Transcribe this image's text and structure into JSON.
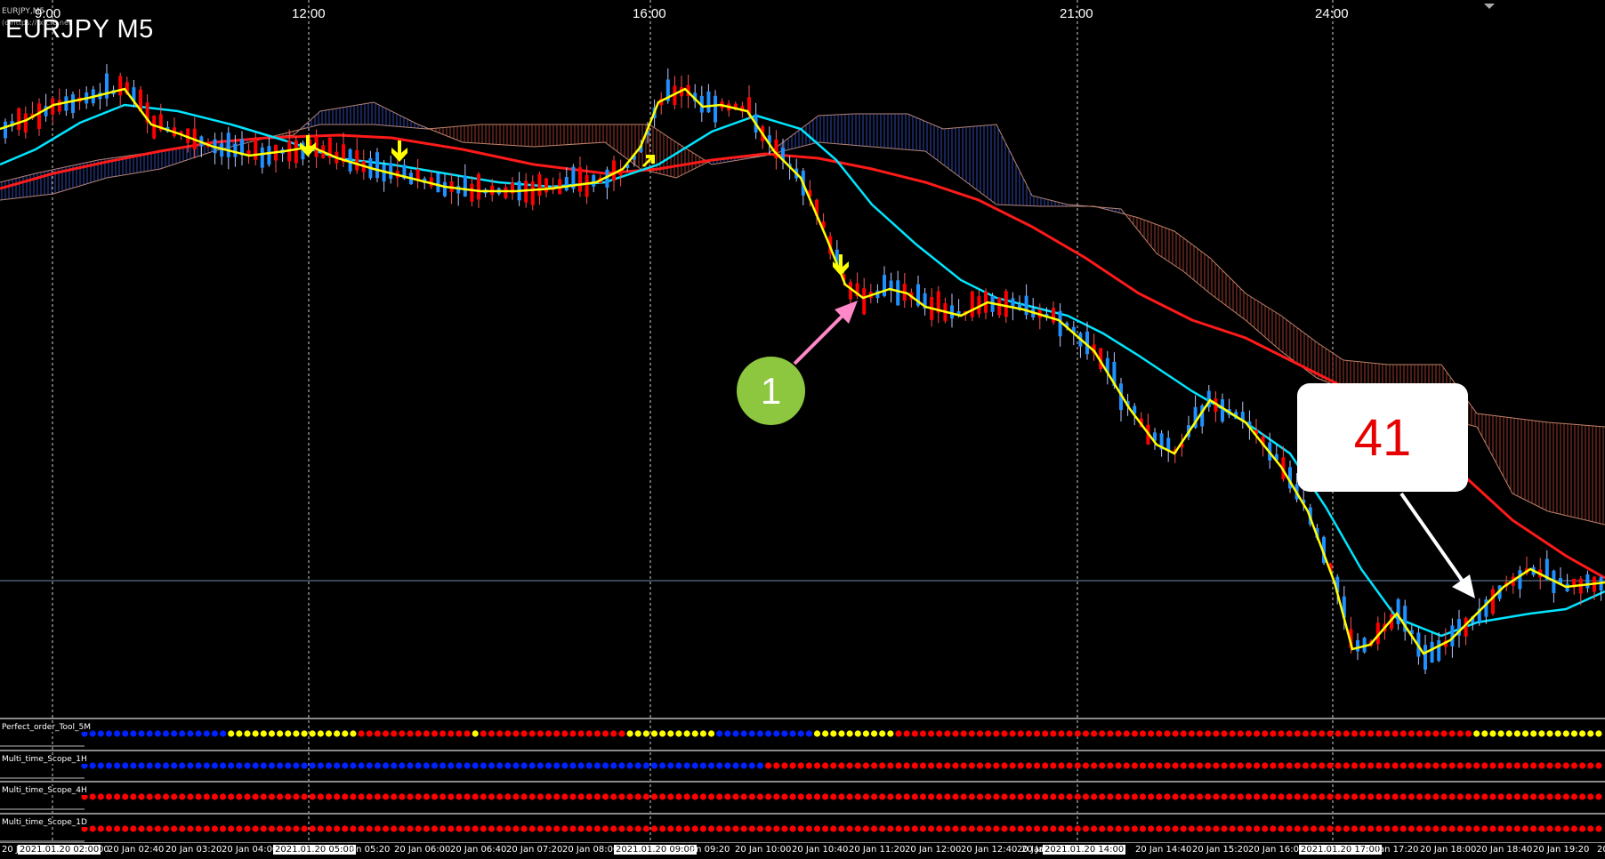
{
  "window": {
    "tab_label": "EURJPY,M5",
    "symbol_title": "EURJPY M5",
    "watermark": "(c)https://fx-ctb.net"
  },
  "top_time_labels": [
    "9:00",
    "12:00",
    "16:00",
    "21:00",
    "24:00"
  ],
  "annotations": {
    "marker_number": "1",
    "count_badge": "41"
  },
  "indicator_panels": [
    {
      "label": "Perfect_order_Tool_5M",
      "segments": [
        [
          "blue",
          18
        ],
        [
          "yellow",
          16
        ],
        [
          "red",
          14
        ],
        [
          "yellow",
          1
        ],
        [
          "red",
          18
        ],
        [
          "yellow",
          11
        ],
        [
          "blue",
          12
        ],
        [
          "yellow",
          10
        ],
        [
          "red",
          71
        ],
        [
          "yellow",
          16
        ]
      ]
    },
    {
      "label": "Multi_time_Scope_1H",
      "segments": [
        [
          "blue",
          84
        ],
        [
          "red",
          103
        ]
      ]
    },
    {
      "label": "Multi_time_Scope_4H",
      "segments": [
        [
          "red",
          187
        ]
      ]
    },
    {
      "label": "Multi_time_Scope_1D",
      "segments": [
        [
          "red",
          187
        ]
      ]
    }
  ],
  "bottom_time_labels": [
    {
      "text": "20 Jan",
      "hl": false
    },
    {
      "text": "2021.01.20 02:00",
      "hl": true
    },
    {
      "text": "00",
      "hl": false
    },
    {
      "text": "20 Jan 02:40",
      "hl": false
    },
    {
      "text": "20 Jan 03:20",
      "hl": false
    },
    {
      "text": "20 Jan 04:00",
      "hl": false
    },
    {
      "text": "2021.01.20 05:00",
      "hl": true
    },
    {
      "text": "Jan 05:20",
      "hl": false
    },
    {
      "text": "20 Jan 06:00",
      "hl": false
    },
    {
      "text": "20 Jan 06:40",
      "hl": false
    },
    {
      "text": "20 Jan 07:20",
      "hl": false
    },
    {
      "text": "20 Jan 08:00",
      "hl": false
    },
    {
      "text": "2021.01.20 09:00",
      "hl": true
    },
    {
      "text": "Jan 09:20",
      "hl": false
    },
    {
      "text": "20 Jan 10:00",
      "hl": false
    },
    {
      "text": "20 Jan 10:40",
      "hl": false
    },
    {
      "text": "20 Jan 11:20",
      "hl": false
    },
    {
      "text": "20 Jan 12:00",
      "hl": false
    },
    {
      "text": "20 Jan 12:40",
      "hl": false
    },
    {
      "text": "20 Jan 13:20",
      "hl": false
    },
    {
      "text": "20 Jan",
      "hl": false
    },
    {
      "text": "2021.01.20 14:00",
      "hl": true
    },
    {
      "text": "20 Jan 14:40",
      "hl": false
    },
    {
      "text": "20 Jan 15:20",
      "hl": false
    },
    {
      "text": "20 Jan 16:00",
      "hl": false
    },
    {
      "text": "2021.01.20 17:00",
      "hl": true
    },
    {
      "text": "Jan 17:20",
      "hl": false
    },
    {
      "text": "20 Jan 18:00",
      "hl": false
    },
    {
      "text": "20 Jan 18:40",
      "hl": false
    },
    {
      "text": "20 Jan 19:20",
      "hl": false
    },
    {
      "text": "20",
      "hl": false
    }
  ],
  "colors": {
    "background": "#000000",
    "bull_candle": "#1e90ff",
    "bear_candle": "#ff0000",
    "ema_fast": "#ffff00",
    "ema_mid": "#00e5ff",
    "ema_slow": "#ff1a1a",
    "cloud": "#c08870",
    "dot_blue": "#0022ff",
    "dot_yellow": "#ffff00",
    "dot_red": "#ff0000",
    "badge_text": "#e60000",
    "marker_green": "#8dc63f",
    "arrow_pink": "#ff88c8"
  }
}
